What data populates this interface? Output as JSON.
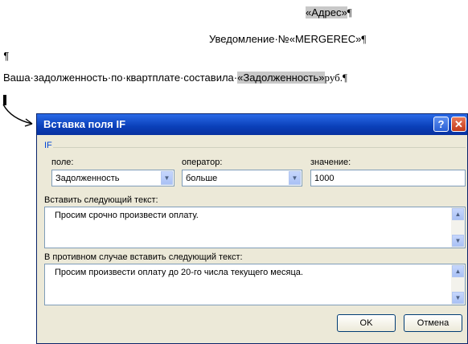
{
  "document": {
    "address_field": "«Адрес»",
    "notice_prefix": "Уведомление·№«MERGEREC»",
    "para_mark": "¶",
    "debt_text": "Ваша·задолженность·по·квартплате·составила·",
    "debt_field": "«Задолженность»",
    "debt_suffix": "руб."
  },
  "dialog": {
    "title": "Вставка поля IF",
    "help_label": "?",
    "close_label": "✕",
    "group_label": "IF",
    "field_label": "поле:",
    "field_value": "Задолженность",
    "operator_label": "оператор:",
    "operator_value": "больше",
    "value_label": "значение:",
    "value_value": "1000",
    "insert_label": "Вставить следующий текст:",
    "insert_text": "Просим срочно произвести оплату.",
    "else_label": "В противном случае вставить следующий текст:",
    "else_text": "Просим произвести оплату до 20-го числа текущего месяца.",
    "ok_label": "OK",
    "cancel_label": "Отмена"
  },
  "icons": [
    "dropdown-arrow-icon",
    "scroll-up-icon",
    "scroll-down-icon",
    "arrow-pointer-icon"
  ]
}
